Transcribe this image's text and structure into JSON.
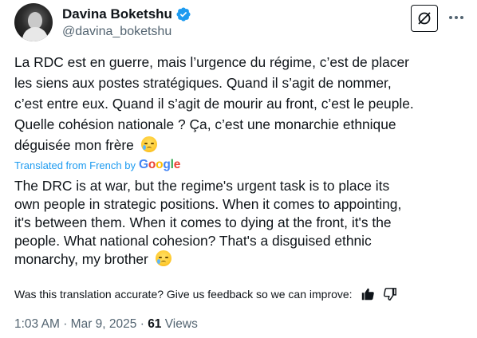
{
  "author": {
    "name": "Davina Boketshu",
    "handle": "@davina_boketshu",
    "verified": true,
    "avatar_icon": "avatar-photo"
  },
  "actions": {
    "grok_icon": "grok-icon",
    "more_icon": "more-icon"
  },
  "tweet": {
    "original_text": "La RDC est en guerre, mais l’urgence du régime, c’est de placer\nles siens aux postes stratégiques. Quand il s’agit de nommer,\nc’est entre eux. Quand il s’agit de mourir au front, c’est le peuple.\nQuelle cohésion nationale ? Ça, c’est une monarchie ethnique\ndéguisée mon frère",
    "translated_from": "Translated from French by",
    "translation_provider": "Google",
    "translation_text": "The DRC is at war, but the regime's urgent task is to place its\nown people in strategic positions. When it comes to appointing,\nit's between them. When it comes to dying at the front, it's the\npeople. What national cohesion? That's a disguised ethnic\nmonarchy, my brother",
    "emoji": "crying-face"
  },
  "feedback": {
    "prompt": "Was this translation accurate? Give us feedback so we can improve:",
    "thumbs_up_icon": "thumbs-up-icon",
    "thumbs_down_icon": "thumbs-down-icon"
  },
  "meta": {
    "time": "1:03 AM",
    "separator": "·",
    "date": "Mar 9, 2025",
    "views_count": "61",
    "views_label": "Views"
  },
  "colors": {
    "link": "#1d9bf0",
    "secondary": "#536471",
    "text": "#0f1419",
    "verified": "#1d9bf0"
  }
}
